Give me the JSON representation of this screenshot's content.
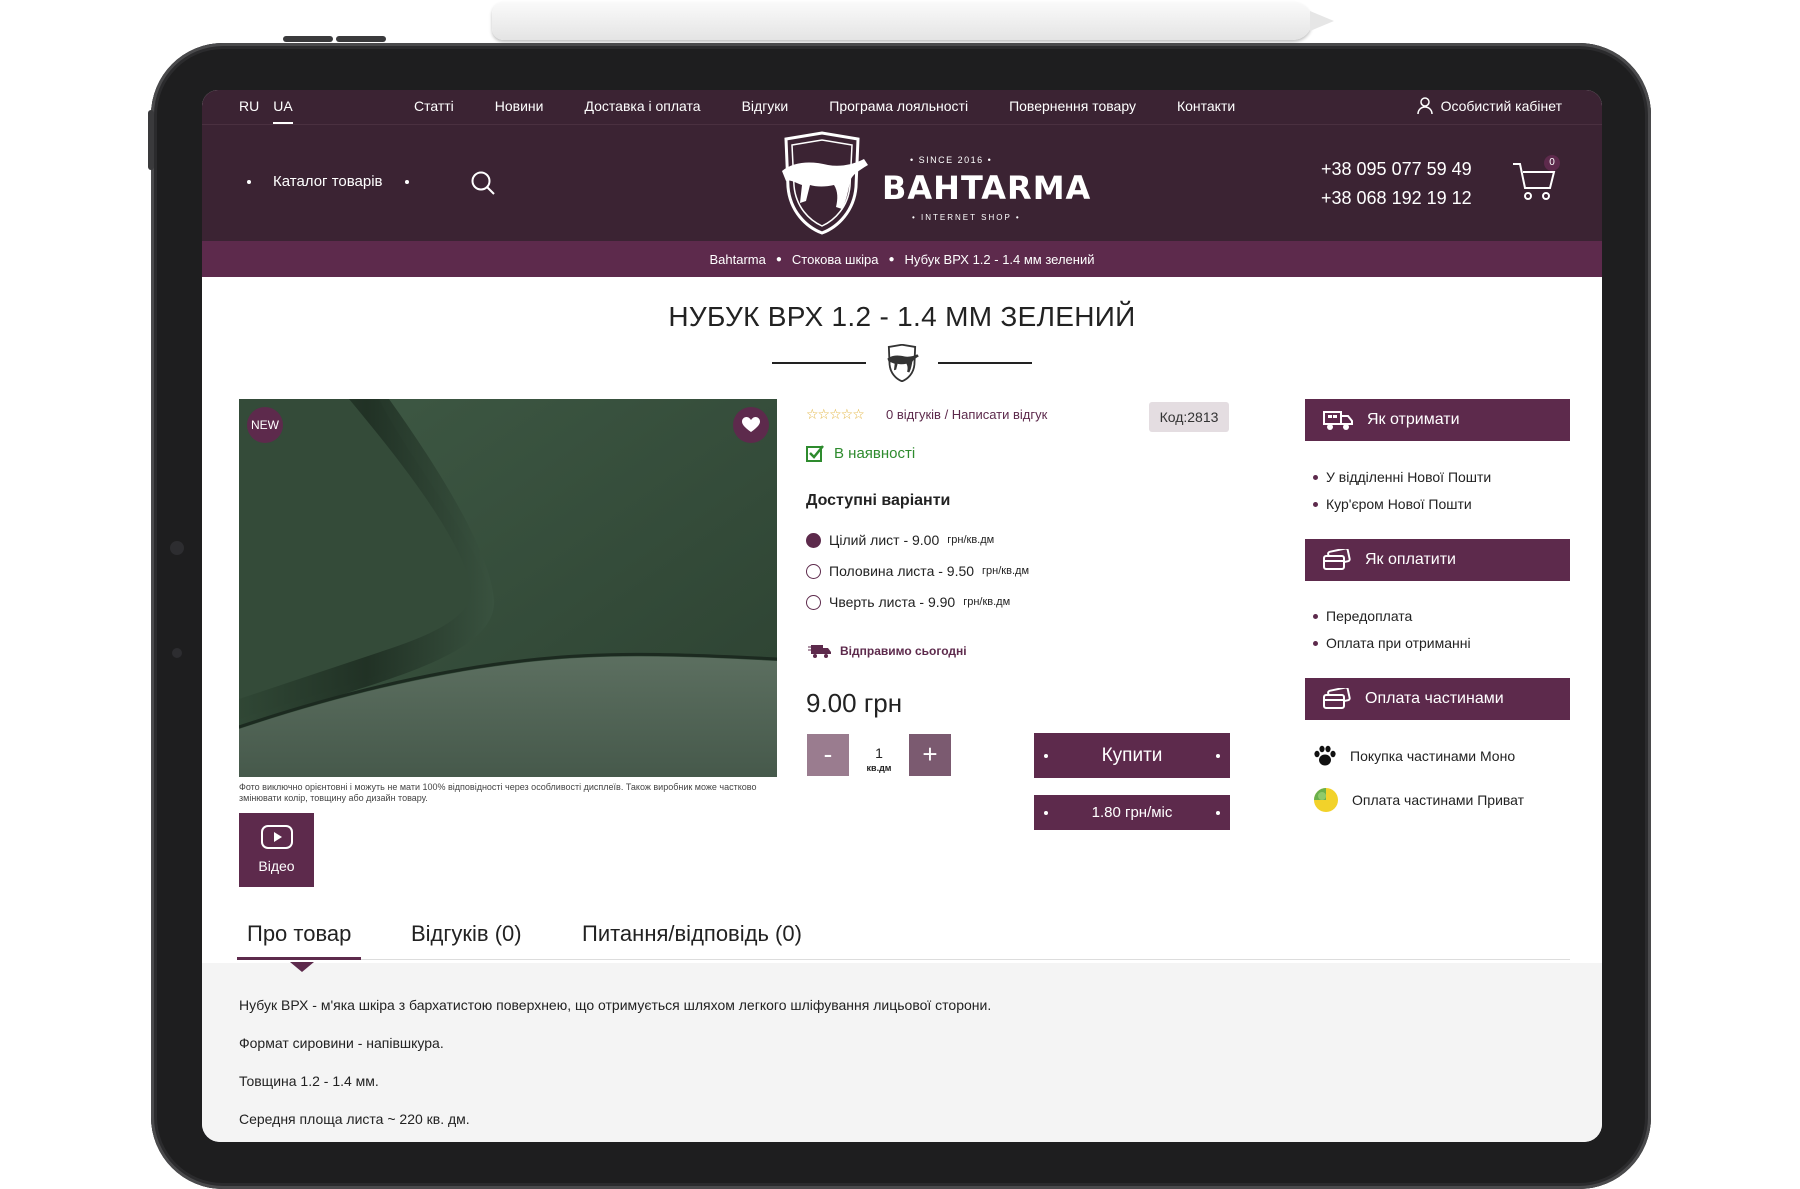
{
  "lang": {
    "ru": "RU",
    "ua": "UA"
  },
  "nav": [
    "Статті",
    "Новини",
    "Доставка і оплата",
    "Відгуки",
    "Програма лояльності",
    "Повернення товару",
    "Контакти"
  ],
  "cabinet": "Особистий кабінет",
  "catalog": "Каталог товарів",
  "logo": {
    "name": "BAHTARMA",
    "since": "• SINCE 2016 •",
    "shop": "• INTERNET SHOP •"
  },
  "phones": [
    "+38 095 077 59 49",
    "+38 068 192 19 12"
  ],
  "cart_count": "0",
  "breadcrumbs": [
    "Bahtarma",
    "Стокова шкіра",
    "Нубук ВРХ 1.2 - 1.4 мм зелений"
  ],
  "product": {
    "title": "НУБУК ВРХ 1.2 - 1.4 ММ ЗЕЛЕНИЙ",
    "badge": "NEW",
    "image_note": "Фото виключно орієнтовні і можуть не мати 100% відповідності через особливості дисплеїв. Також виробник може частково змінювати колір, товщину або дизайн товару.",
    "video": "Відео",
    "reviews": "0 відгуків",
    "review_sep": " / ",
    "write_review": "Написати відгук",
    "code": "Код:2813",
    "stock": "В наявності",
    "variants_title": "Доступні варіанти",
    "variants": [
      {
        "label": "Цілий лист - 9.00",
        "unit": "грн/кв.дм",
        "selected": true
      },
      {
        "label": "Половина листа - 9.50",
        "unit": "грн/кв.дм",
        "selected": false
      },
      {
        "label": "Чверть листа - 9.90",
        "unit": "грн/кв.дм",
        "selected": false
      }
    ],
    "ship_today": "Відправимо сьогодні",
    "price": "9.00 грн",
    "qty": {
      "minus": "-",
      "value": "1",
      "unit": "кв.дм",
      "plus": "+"
    },
    "buy": "Купити",
    "installment": "1.80 грн/міс"
  },
  "delivery": {
    "title": "Як отримати",
    "items": [
      "У відділенні Нової Пошти",
      "Кур'єром Нової Пошти"
    ]
  },
  "payment": {
    "title": "Як оплатити",
    "items": [
      "Передоплата",
      "Оплата при отриманні"
    ]
  },
  "installments": {
    "title": "Оплата частинами",
    "items": [
      "Покупка частинами Моно",
      "Оплата частинами Приват"
    ]
  },
  "tabs": [
    "Про товар",
    "Відгуків (0)",
    "Питання/відповідь (0)"
  ],
  "description": [
    "Нубук ВРХ - м'яка шкіра з бархатистою поверхнею, що отримується шляхом легкого шліфування лицьової сторони.",
    "Формат сировини - напівшкура.",
    "Товщина 1.2 - 1.4 мм.",
    "Середня площа листа ~ 220 кв. дм."
  ],
  "colors": {
    "header": "#3b2333",
    "accent": "#5d2a4c",
    "stock": "#2e8b2e"
  }
}
